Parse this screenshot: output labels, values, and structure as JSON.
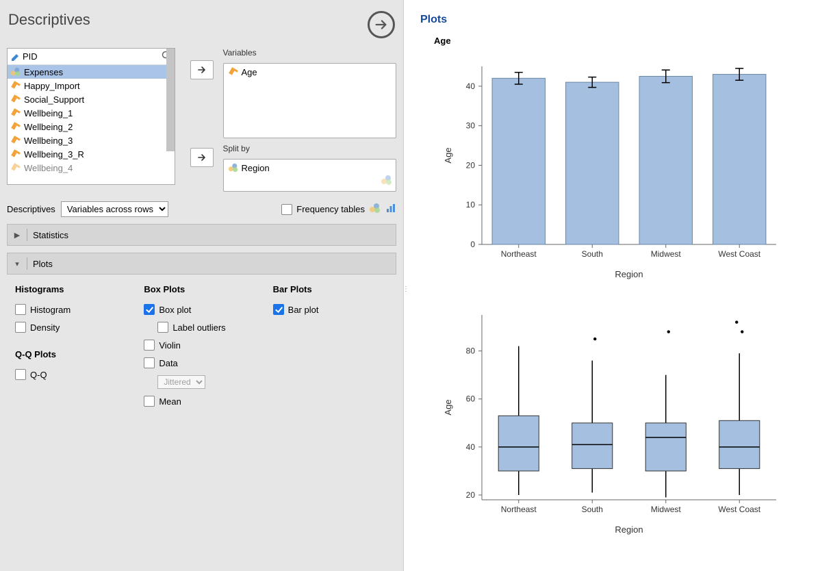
{
  "panel": {
    "title": "Descriptives"
  },
  "filter": {
    "value": "PID"
  },
  "available_vars": [
    {
      "name": "Expenses",
      "type": "nominal",
      "selected": true
    },
    {
      "name": "Happy_Import",
      "type": "scale"
    },
    {
      "name": "Social_Support",
      "type": "scale"
    },
    {
      "name": "Wellbeing_1",
      "type": "scale"
    },
    {
      "name": "Wellbeing_2",
      "type": "scale"
    },
    {
      "name": "Wellbeing_3",
      "type": "scale"
    },
    {
      "name": "Wellbeing_3_R",
      "type": "scale"
    },
    {
      "name": "Wellbeing_4",
      "type": "scale",
      "partial": true
    }
  ],
  "boxes": {
    "variables_label": "Variables",
    "variables": [
      {
        "name": "Age",
        "type": "scale"
      }
    ],
    "split_label": "Split by",
    "split": [
      {
        "name": "Region",
        "type": "nominal"
      }
    ]
  },
  "descriptives_row": {
    "label": "Descriptives",
    "mode_options": "Variables across rows",
    "freq_label": "Frequency tables"
  },
  "sections": {
    "statistics": "Statistics",
    "plots": "Plots"
  },
  "plots_panel": {
    "histograms_h": "Histograms",
    "histogram": "Histogram",
    "density": "Density",
    "qq_h": "Q-Q Plots",
    "qq": "Q-Q",
    "box_h": "Box Plots",
    "boxplot": "Box plot",
    "label_outliers": "Label outliers",
    "violin": "Violin",
    "data": "Data",
    "data_mode": "Jittered",
    "mean": "Mean",
    "bar_h": "Bar Plots",
    "barplot": "Bar plot",
    "checked": {
      "histogram": false,
      "density": false,
      "qq": false,
      "boxplot": true,
      "label_outliers": false,
      "violin": false,
      "data": false,
      "mean": false,
      "barplot": true
    }
  },
  "results": {
    "title": "Plots",
    "subtitle": "Age"
  },
  "chart_data": [
    {
      "type": "bar",
      "title": "",
      "xlabel": "Region",
      "ylabel": "Age",
      "categories": [
        "Northeast",
        "South",
        "Midwest",
        "West Coast"
      ],
      "values": [
        42,
        41,
        42.5,
        43
      ],
      "error": [
        1.5,
        1.3,
        1.6,
        1.5
      ],
      "ylim": [
        0,
        45
      ],
      "yticks": [
        0,
        10,
        20,
        30,
        40
      ]
    },
    {
      "type": "box",
      "title": "",
      "xlabel": "Region",
      "ylabel": "Age",
      "categories": [
        "Northeast",
        "South",
        "Midwest",
        "West Coast"
      ],
      "boxes": [
        {
          "min": 20,
          "q1": 30,
          "median": 40,
          "q3": 53,
          "max": 82,
          "outliers": []
        },
        {
          "min": 21,
          "q1": 31,
          "median": 41,
          "q3": 50,
          "max": 76,
          "outliers": [
            85
          ]
        },
        {
          "min": 19,
          "q1": 30,
          "median": 44,
          "q3": 50,
          "max": 70,
          "outliers": [
            88
          ]
        },
        {
          "min": 20,
          "q1": 31,
          "median": 40,
          "q3": 51,
          "max": 79,
          "outliers": [
            88,
            92
          ]
        }
      ],
      "ylim": [
        18,
        95
      ],
      "yticks": [
        20,
        40,
        60,
        80
      ]
    }
  ]
}
